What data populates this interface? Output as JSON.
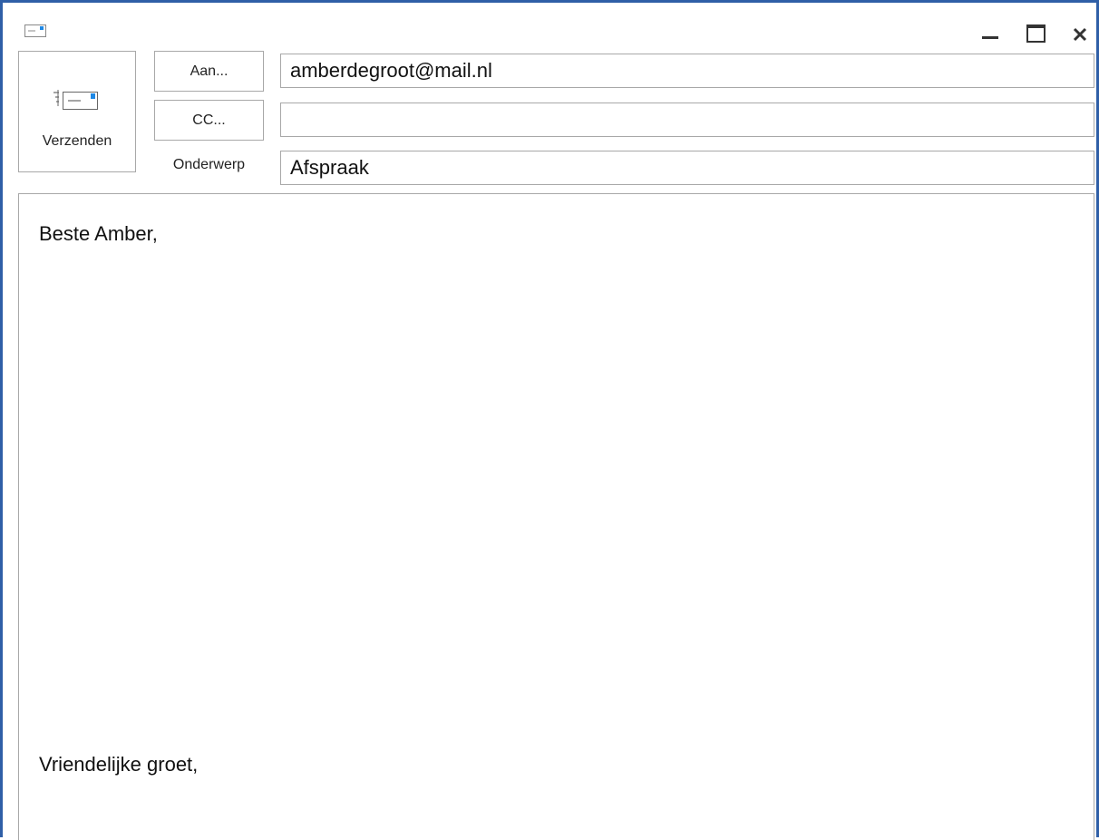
{
  "window": {
    "accent_color": "#2f5fa7",
    "icons": [
      "envelope-icon",
      "minimize-icon",
      "maximize-icon",
      "close-icon"
    ]
  },
  "toolbar": {
    "send_label": "Verzenden",
    "send_icon": "send-envelope-icon",
    "to_button_label": "Aan...",
    "cc_button_label": "CC...",
    "subject_label": "Onderwerp"
  },
  "fields": {
    "to_value": "amberdegroot@mail.nl",
    "cc_value": "",
    "subject_value": "Afspraak"
  },
  "message": {
    "greeting": "Beste Amber,",
    "closing": "Vriendelijke groet,"
  }
}
